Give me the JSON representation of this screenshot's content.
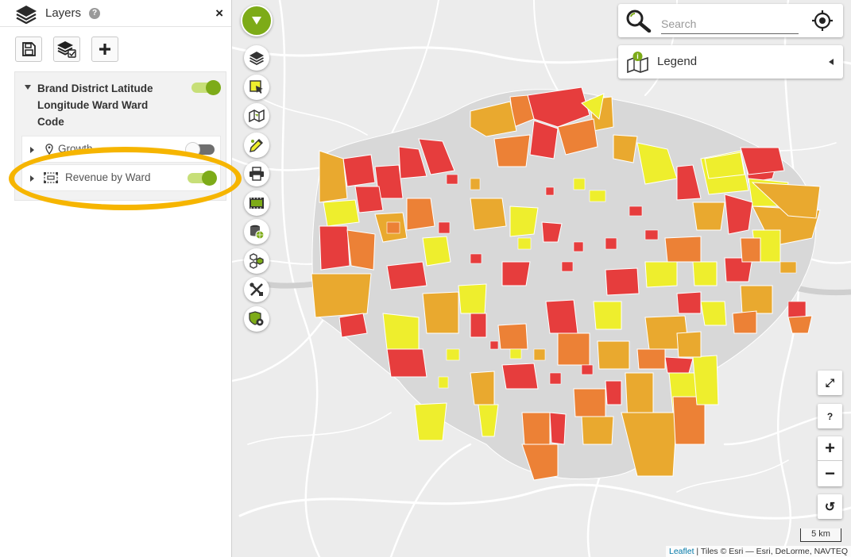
{
  "sidebar": {
    "title": "Layers",
    "help": "?",
    "close": "×",
    "toolbar": [
      "save-button",
      "layers-settings-button",
      "add-layer-button"
    ],
    "group": {
      "title": "Brand District Latitude Longitude Ward Ward Code",
      "enabled": true,
      "layers": [
        {
          "label": "Growth",
          "enabled": false,
          "icon": "map-pin-icon"
        },
        {
          "label": "Revenue by Ward",
          "enabled": true,
          "icon": "polygon-icon"
        }
      ]
    }
  },
  "map": {
    "search": {
      "placeholder": "Search"
    },
    "legend": {
      "label": "Legend"
    },
    "controls": {
      "fullscreen": "⤢",
      "help": "?",
      "zoom_in": "+",
      "zoom_out": "−",
      "reset": "↺"
    },
    "scale": "5 km",
    "attribution": {
      "leaflet": "Leaflet",
      "rest": " | Tiles © Esri — Esri, DeLorme, NAVTEQ"
    },
    "tools": [
      "layers-icon",
      "select-icon",
      "map-icon",
      "draw-icon",
      "print-icon",
      "video-icon",
      "data-globe-icon",
      "hexbin-icon",
      "tools-icon",
      "settings-shield-icon"
    ],
    "colors": {
      "red": "#e63d3d",
      "orange": "#ec8136",
      "amber": "#e9a92f",
      "yellow": "#eeee2d",
      "accent": "#7dab18"
    }
  }
}
